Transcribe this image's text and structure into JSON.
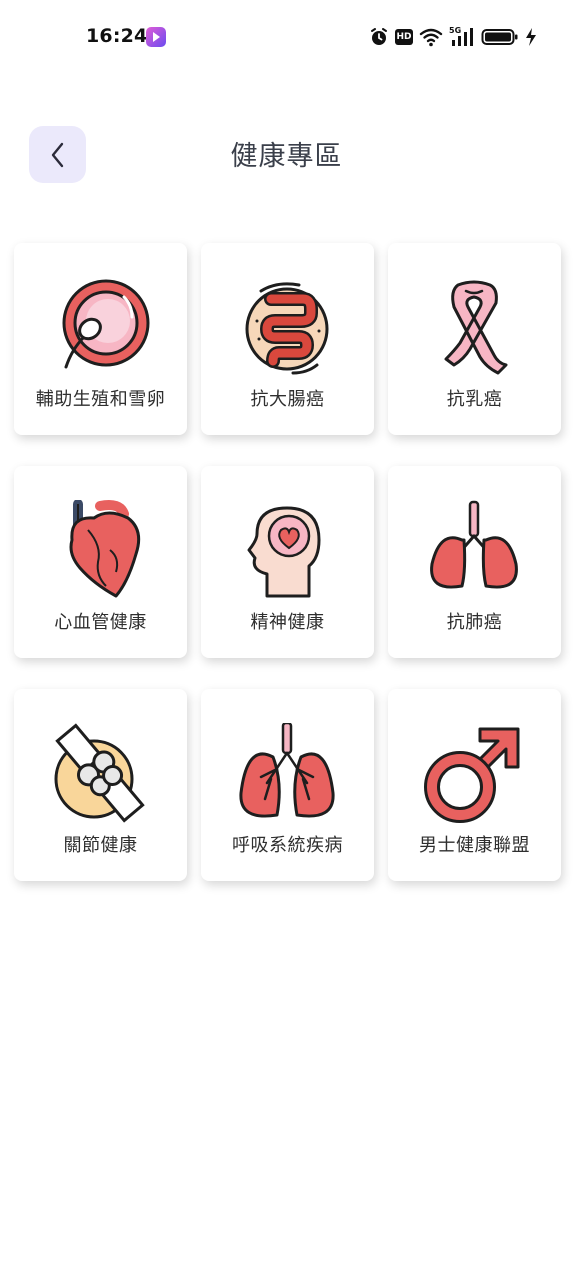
{
  "status_bar": {
    "time": "16:24",
    "icons": [
      "alarm-icon",
      "hd-icon",
      "wifi-icon",
      "5g-signal-icon",
      "battery-icon",
      "charging-icon"
    ],
    "hd_text": "HD",
    "network_text": "5G"
  },
  "header": {
    "back_icon": "chevron-left-icon",
    "title": "健康專區"
  },
  "topics": [
    {
      "label": "輔助生殖和雪卵",
      "icon": "egg-sperm-icon"
    },
    {
      "label": "抗大腸癌",
      "icon": "intestine-icon"
    },
    {
      "label": "抗乳癌",
      "icon": "pink-ribbon-icon"
    },
    {
      "label": "心血管健康",
      "icon": "heart-organ-icon"
    },
    {
      "label": "精神健康",
      "icon": "head-heart-icon"
    },
    {
      "label": "抗肺癌",
      "icon": "lungs-icon"
    },
    {
      "label": "關節健康",
      "icon": "knee-joint-icon"
    },
    {
      "label": "呼吸系統疾病",
      "icon": "respiratory-lungs-icon"
    },
    {
      "label": "男士健康聯盟",
      "icon": "male-symbol-icon"
    }
  ],
  "colors": {
    "accent_bg": "#ebe9fb",
    "icon_red": "#e8615f",
    "icon_pink": "#f7b6c4",
    "icon_skin": "#f6d7b9",
    "outline": "#1e1e1e"
  }
}
